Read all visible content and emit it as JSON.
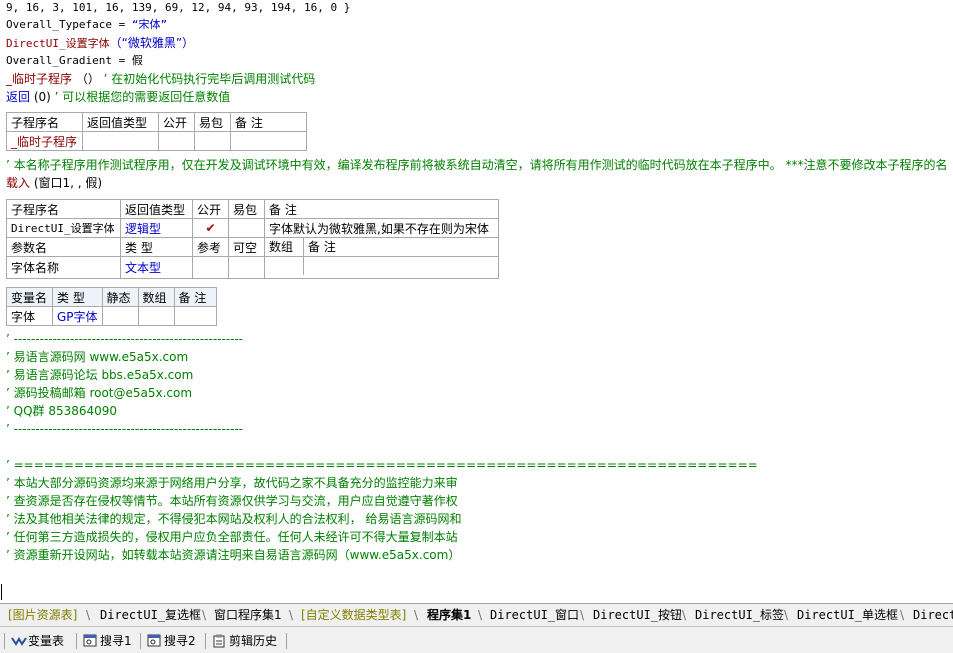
{
  "code_lines": {
    "l1": "9, 16, 3, 101, 16, 139, 69, 12, 94, 93, 194, 16, 0 }",
    "l2_name": "Overall_Typeface",
    "l2_eq": " = ",
    "l2_val": "“宋体”",
    "l3_func": "DirectUI_设置字体",
    "l3_args": "（“微软雅黑”）",
    "l4_name": "Overall_Gradient",
    "l4_eq": " = ",
    "l4_val": "假",
    "l5_func": "_临时子程序",
    "l5_args": " （） ",
    "l5_cmt": "’ 在初始化代码执行完毕后调用测试代码",
    "l6_func": "返回",
    "l6_args": " (0) ",
    "l6_cmt": "’ 可以根据您的需要返回任意数值",
    "l8_cmt": "’ 本名称子程序用作测试程序用，仅在开发及调试环境中有效，编译发布程序前将被系统自动清空，请将所有用作测试的临时代码放在本子程序中。 ***注意不要修改本子程序的名",
    "l9_func": "载入",
    "l9_args": " (窗口1, , 假)"
  },
  "table1": {
    "headers": [
      "子程序名",
      "返回值类型",
      "公开",
      "易包",
      "备 注"
    ],
    "row": [
      "_临时子程序",
      "",
      "",
      "",
      ""
    ]
  },
  "table2": {
    "headers": [
      "子程序名",
      "返回值类型",
      "公开",
      "易包",
      "备 注"
    ],
    "row": [
      "DirectUI_设置字体",
      "逻辑型",
      "✔",
      "",
      "字体默认为微软雅黑,如果不存在则为宋体"
    ],
    "param_headers": [
      "参数名",
      "类 型",
      "参考",
      "可空",
      "数组",
      "备 注"
    ],
    "param_row": [
      "字体名称",
      "文本型",
      "",
      "",
      "",
      ""
    ]
  },
  "table3": {
    "headers": [
      "变量名",
      "类 型",
      "静态",
      "数组",
      "备 注"
    ],
    "row": [
      "字体",
      "GP字体",
      "",
      "",
      ""
    ]
  },
  "comments1": [
    "’ -----------------------------------------------------",
    "’ 易语言源码网     www.e5a5x.com",
    "’ 易语言源码论坛     bbs.e5a5x.com",
    "’ 源码投稿邮箱  root@e5a5x.com",
    "’ QQ群    853864090",
    "’ -----------------------------------------------------"
  ],
  "comments2": [
    "’ ==========================================================================",
    "’ 本站大部分源码资源均来源于网络用户分享，故代码之家不具备充分的监控能力来审",
    "’ 查资源是否存在侵权等情节。本站所有资源仅供学习与交流，用户应自觉遵守著作权",
    "’ 法及其他相关法律的规定，不得侵犯本网站及权利人的合法权利， 给易语言源码网和",
    "’ 任何第三方造成损失的，侵权用户应负全部责任。任何人未经许可不得大量复制本站",
    "’ 资源重新开设网站，如转载本站资源请注明来自易语言源码网（www.e5a5x.com）"
  ],
  "tabs": [
    {
      "label": "[图片资源表]",
      "kind": "res"
    },
    {
      "label": "DirectUI_复选框",
      "kind": "normal"
    },
    {
      "label": "窗口程序集1",
      "kind": "normal"
    },
    {
      "label": "[自定义数据类型表]",
      "kind": "res"
    },
    {
      "label": "程序集1",
      "kind": "active"
    },
    {
      "label": "DirectUI_窗口",
      "kind": "normal"
    },
    {
      "label": "DirectUI_按钮",
      "kind": "normal"
    },
    {
      "label": "DirectUI_标签",
      "kind": "normal"
    },
    {
      "label": "DirectUI_单选框",
      "kind": "normal"
    },
    {
      "label": "DirectU",
      "kind": "normal"
    }
  ],
  "bottom_buttons": {
    "vars": "变量表",
    "search1": "搜寻1",
    "search2": "搜寻2",
    "clip": "剪辑历史"
  },
  "colors": {
    "comment": "#008000",
    "keyword": "#8b0000",
    "type": "#0000cc",
    "resource_tab": "#808000"
  }
}
